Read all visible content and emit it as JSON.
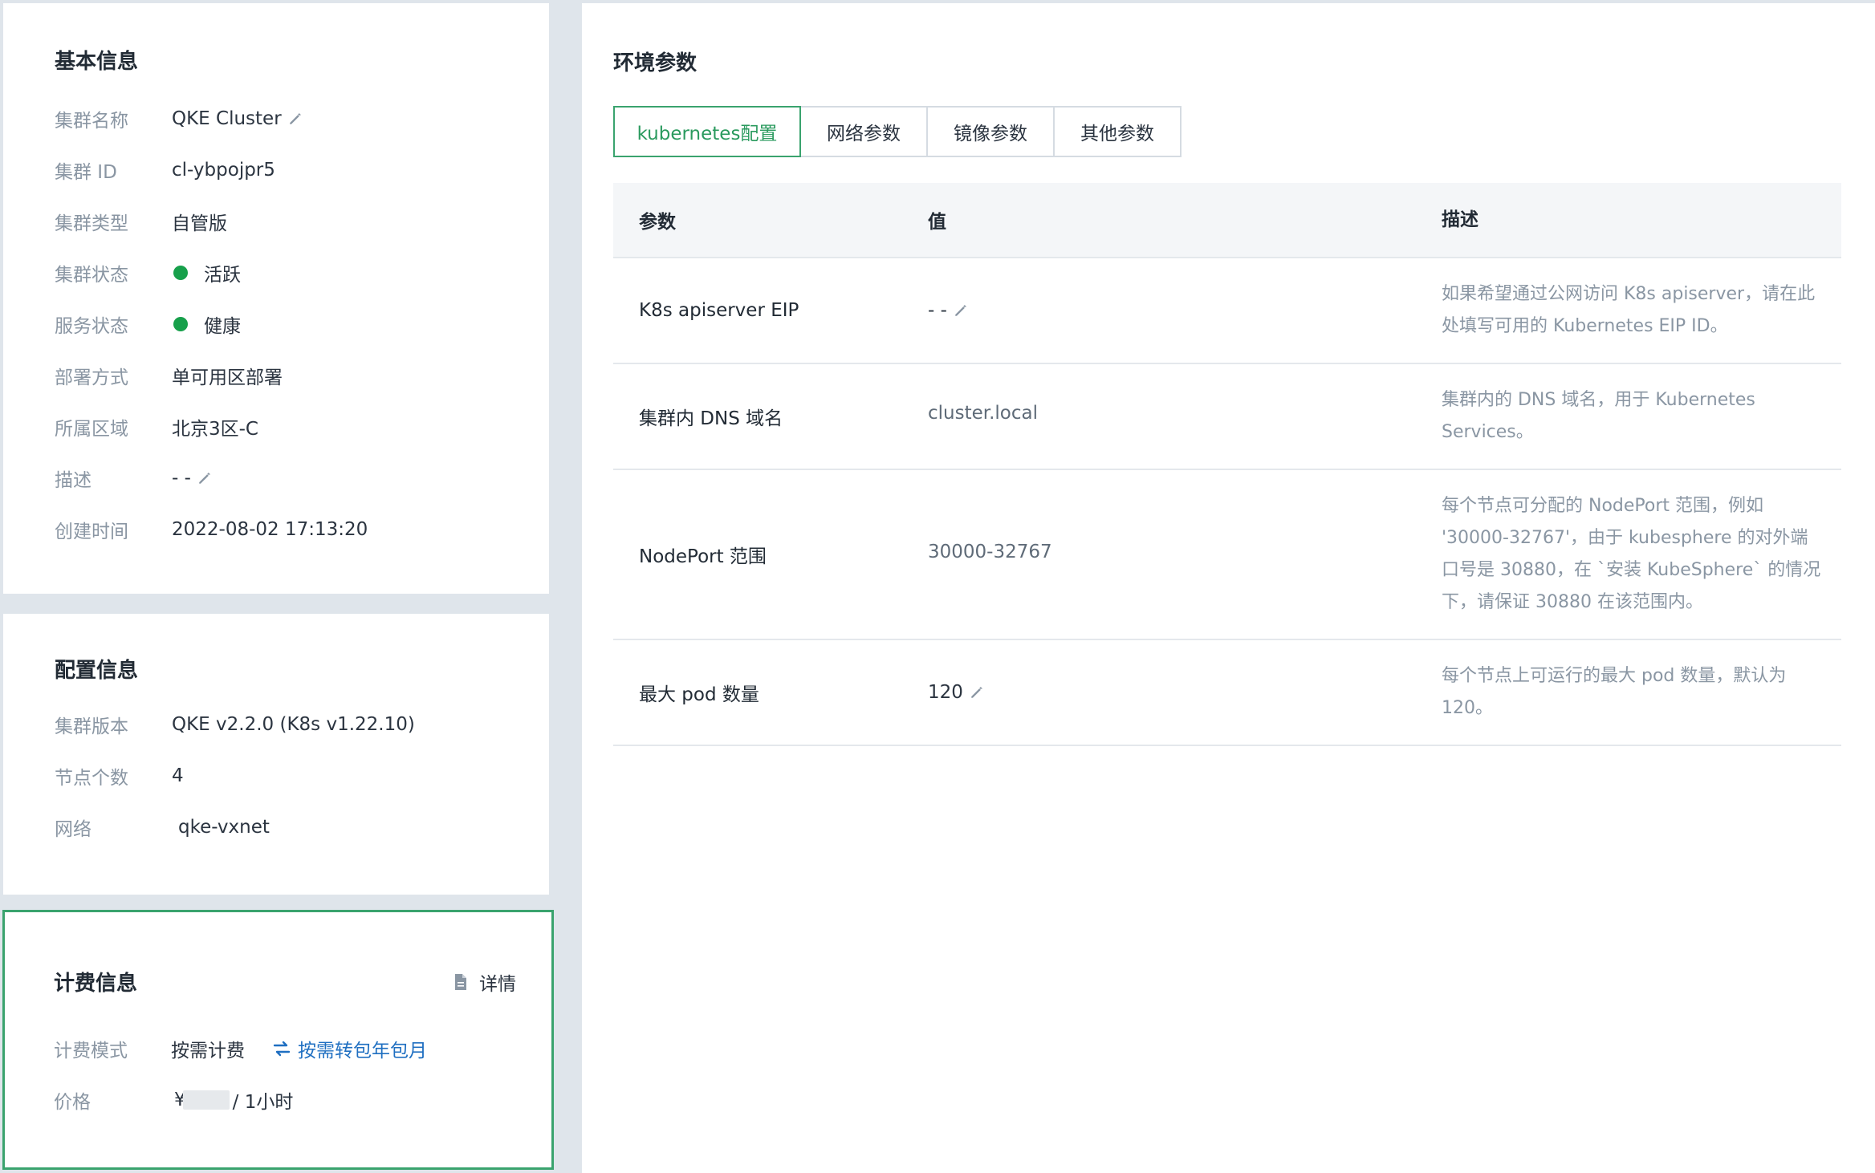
{
  "basic": {
    "title": "基本信息",
    "rows": [
      {
        "label": "集群名称",
        "value": "QKE Cluster",
        "editable": true
      },
      {
        "label": "集群 ID",
        "value": "cl-ybpojpr5"
      },
      {
        "label": "集群类型",
        "value": "自管版"
      },
      {
        "label": "集群状态",
        "value": "活跃",
        "status_color": "#17a04b"
      },
      {
        "label": "服务状态",
        "value": "健康",
        "status_color": "#17a04b"
      },
      {
        "label": "部署方式",
        "value": "单可用区部署"
      },
      {
        "label": "所属区域",
        "value": "北京3区-C"
      },
      {
        "label": "描述",
        "value": "- -",
        "editable": true
      },
      {
        "label": "创建时间",
        "value": "2022-08-02 17:13:20"
      }
    ]
  },
  "config": {
    "title": "配置信息",
    "rows": [
      {
        "label": "集群版本",
        "value": "QKE v2.2.0 (K8s v1.22.10)"
      },
      {
        "label": "节点个数",
        "value": "4"
      },
      {
        "label": "网络",
        "value": "qke-vxnet",
        "link": true
      }
    ]
  },
  "billing": {
    "title": "计费信息",
    "detail_label": "详情",
    "mode_label": "计费模式",
    "mode_value": "按需计费",
    "switch_label": "按需转包年包月",
    "price_label": "价格",
    "price_prefix": "¥",
    "price_suffix": "/ 1小时"
  },
  "env": {
    "title": "环境参数",
    "tabs": [
      "kubernetes配置",
      "网络参数",
      "镜像参数",
      "其他参数"
    ],
    "active_tab": 0,
    "columns": [
      "参数",
      "值",
      "描述"
    ],
    "rows": [
      {
        "param": "K8s apiserver EIP",
        "value": "- -",
        "editable": true,
        "desc": "如果希望通过公网访问 K8s apiserver，请在此处填写可用的 Kubernetes EIP ID。"
      },
      {
        "param": "集群内 DNS 域名",
        "value": "cluster.local",
        "desc": "集群内的 DNS 域名，用于 Kubernetes Services。"
      },
      {
        "param": "NodePort 范围",
        "value": "30000-32767",
        "desc": "每个节点可分配的 NodePort 范围，例如 '30000-32767'，由于 kubesphere 的对外端口号是 30880，在 `安装 KubeSphere` 的情况下，请保证 30880 在该范围内。"
      },
      {
        "param": "最大 pod 数量",
        "value": "120",
        "editable": true,
        "desc": "每个节点上可运行的最大 pod 数量，默认为 120。"
      }
    ]
  },
  "colors": {
    "accent": "#3aa36e",
    "link": "#1f6fc1",
    "status_ok": "#17a04b"
  }
}
